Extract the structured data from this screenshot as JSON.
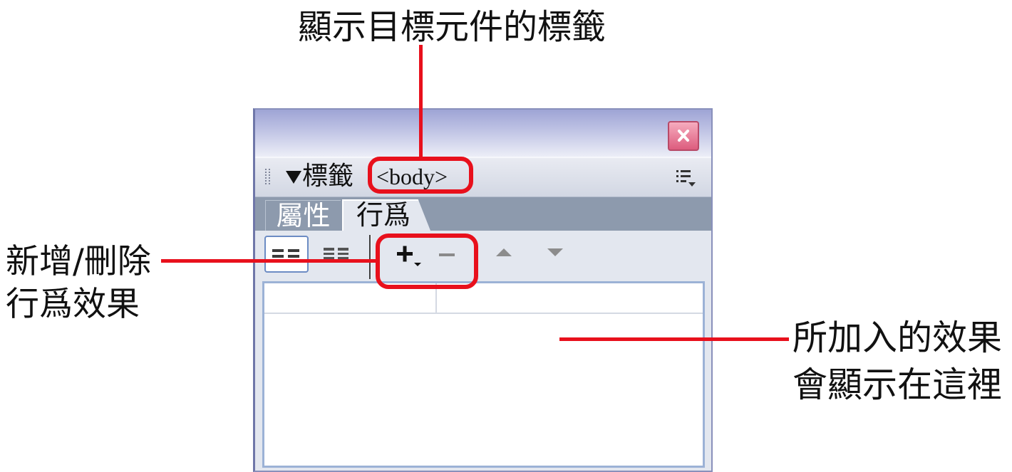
{
  "annotations": {
    "top_label": "顯示目標元件的標籤",
    "left_label": [
      "新增/刪除",
      "行爲效果"
    ],
    "right_label": [
      "所加入的效果",
      "會顯示在這裡"
    ],
    "color": "#e8101c"
  },
  "panel": {
    "title_bar": {
      "close_icon": "close-icon"
    },
    "header": {
      "grip_icon": "grip-icon",
      "collapse_icon": "collapse-triangle-icon",
      "title": "標籤",
      "tag": "<body>",
      "options_icon": "options-menu-icon"
    },
    "tabs": [
      {
        "label": "屬性",
        "active": false
      },
      {
        "label": "行爲",
        "active": true
      }
    ],
    "toolbar": {
      "buttons": [
        {
          "icon": "show-set-events-icon",
          "pressed": true,
          "enabled": true
        },
        {
          "icon": "show-all-events-icon",
          "pressed": false,
          "enabled": true
        },
        {
          "icon": "add-behavior-plus-icon",
          "enabled": true
        },
        {
          "icon": "remove-behavior-minus-icon",
          "enabled": false
        },
        {
          "icon": "move-up-arrow-icon",
          "enabled": false
        },
        {
          "icon": "move-down-arrow-icon",
          "enabled": false
        }
      ]
    },
    "behaviors_list": {
      "rows": []
    }
  },
  "colors": {
    "annotation_red": "#e8101c",
    "titlebar_top": "#9ea4d5",
    "titlebar_bottom": "#eceef7",
    "tabbar": "#8d9aad",
    "panel_bg": "#e3e7ef",
    "list_border": "#9cb2d6",
    "close_button": "#dc5a7c"
  }
}
